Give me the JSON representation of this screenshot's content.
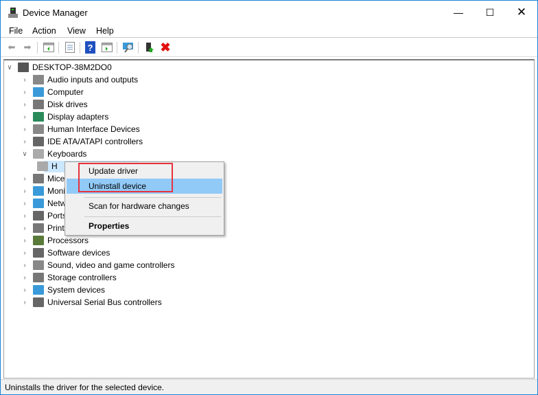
{
  "window": {
    "title": "Device Manager",
    "accent": "#1883d7"
  },
  "menu": [
    "File",
    "Action",
    "View",
    "Help"
  ],
  "toolbar": [
    "back-icon",
    "forward-icon",
    "show-hide-console-tree-icon",
    "properties-icon",
    "help-icon",
    "action-pane-icon",
    "scan-hardware-icon",
    "update-driver-icon",
    "uninstall-icon"
  ],
  "tree": {
    "root": "DESKTOP-38M2DO0",
    "items": [
      {
        "label": "Audio inputs and outputs",
        "icon": "speaker",
        "color": "#888"
      },
      {
        "label": "Computer",
        "icon": "monitor",
        "color": "#3a9ad9"
      },
      {
        "label": "Disk drives",
        "icon": "disk",
        "color": "#777"
      },
      {
        "label": "Display adapters",
        "icon": "display",
        "color": "#2a8a5a"
      },
      {
        "label": "Human Interface Devices",
        "icon": "hid",
        "color": "#888"
      },
      {
        "label": "IDE ATA/ATAPI controllers",
        "icon": "ide",
        "color": "#666"
      },
      {
        "label": "Keyboards",
        "icon": "keyboard",
        "color": "#aaa",
        "expanded": true,
        "children": [
          {
            "label": "H"
          }
        ]
      },
      {
        "label": "Mice",
        "icon": "mouse",
        "color": "#777"
      },
      {
        "label": "Moni",
        "icon": "monitor",
        "color": "#3a9ad9"
      },
      {
        "label": "Netw",
        "icon": "network",
        "color": "#3a9ad9"
      },
      {
        "label": "Ports",
        "icon": "port",
        "color": "#666"
      },
      {
        "label": "Print",
        "icon": "printer",
        "color": "#777"
      },
      {
        "label": "Processors",
        "icon": "cpu",
        "color": "#5a7a3a"
      },
      {
        "label": "Software devices",
        "icon": "software",
        "color": "#666"
      },
      {
        "label": "Sound, video and game controllers",
        "icon": "speaker",
        "color": "#888"
      },
      {
        "label": "Storage controllers",
        "icon": "storage",
        "color": "#777"
      },
      {
        "label": "System devices",
        "icon": "system",
        "color": "#3a9ad9"
      },
      {
        "label": "Universal Serial Bus controllers",
        "icon": "usb",
        "color": "#666"
      }
    ]
  },
  "context_menu": {
    "items": [
      "Update driver",
      "Uninstall device",
      "Scan for hardware changes",
      "Properties"
    ],
    "highlighted": "Uninstall device",
    "annotation_color": "#e8323c"
  },
  "status": "Uninstalls the driver for the selected device."
}
